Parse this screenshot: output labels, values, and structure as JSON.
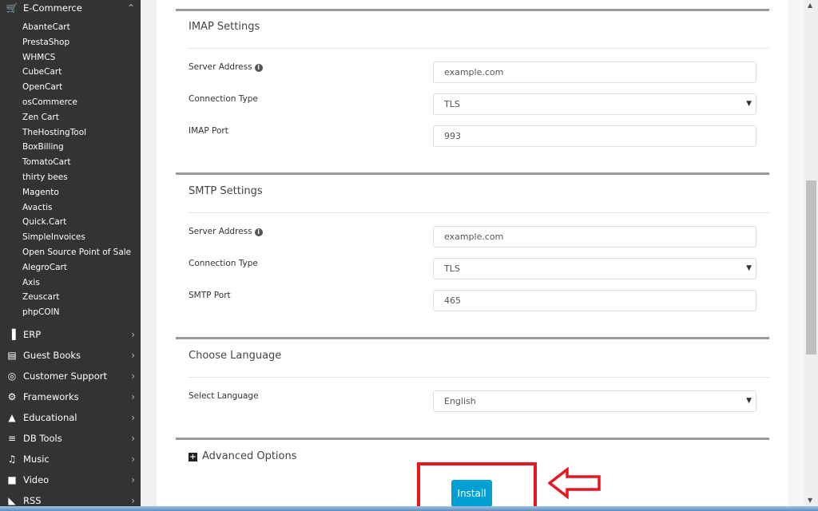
{
  "sidebar": {
    "ecommerce": {
      "label": "E-Commerce",
      "icon": "cart-icon",
      "items": [
        "AbanteCart",
        "PrestaShop",
        "WHMCS",
        "CubeCart",
        "OpenCart",
        "osCommerce",
        "Zen Cart",
        "TheHostingTool",
        "BoxBilling",
        "TomatoCart",
        "thirty bees",
        "Magento",
        "Avactis",
        "Quick.Cart",
        "SimpleInvoices",
        "Open Source Point of Sale",
        "AlegroCart",
        "Axis",
        "Zeuscart",
        "phpCOIN"
      ]
    },
    "categories": [
      {
        "label": "ERP",
        "icon": "bar-chart-icon"
      },
      {
        "label": "Guest Books",
        "icon": "book-icon"
      },
      {
        "label": "Customer Support",
        "icon": "life-ring-icon"
      },
      {
        "label": "Frameworks",
        "icon": "gears-icon"
      },
      {
        "label": "Educational",
        "icon": "graduation-cap-icon"
      },
      {
        "label": "DB Tools",
        "icon": "database-icon"
      },
      {
        "label": "Music",
        "icon": "music-icon"
      },
      {
        "label": "Video",
        "icon": "video-icon"
      },
      {
        "label": "RSS",
        "icon": "rss-icon"
      }
    ]
  },
  "imap": {
    "title": "IMAP Settings",
    "server_label": "Server Address",
    "server_value": "example.com",
    "conn_label": "Connection Type",
    "conn_value": "TLS",
    "port_label": "IMAP Port",
    "port_value": "993"
  },
  "smtp": {
    "title": "SMTP Settings",
    "server_label": "Server Address",
    "server_value": "example.com",
    "conn_label": "Connection Type",
    "conn_value": "TLS",
    "port_label": "SMTP Port",
    "port_value": "465"
  },
  "language": {
    "title": "Choose Language",
    "label": "Select Language",
    "value": "English"
  },
  "advanced": {
    "label": "Advanced Options"
  },
  "install": {
    "label": "Install"
  },
  "colors": {
    "sidebar": "#333333",
    "install": "#00a0d2",
    "highlight": "#e8161e"
  }
}
